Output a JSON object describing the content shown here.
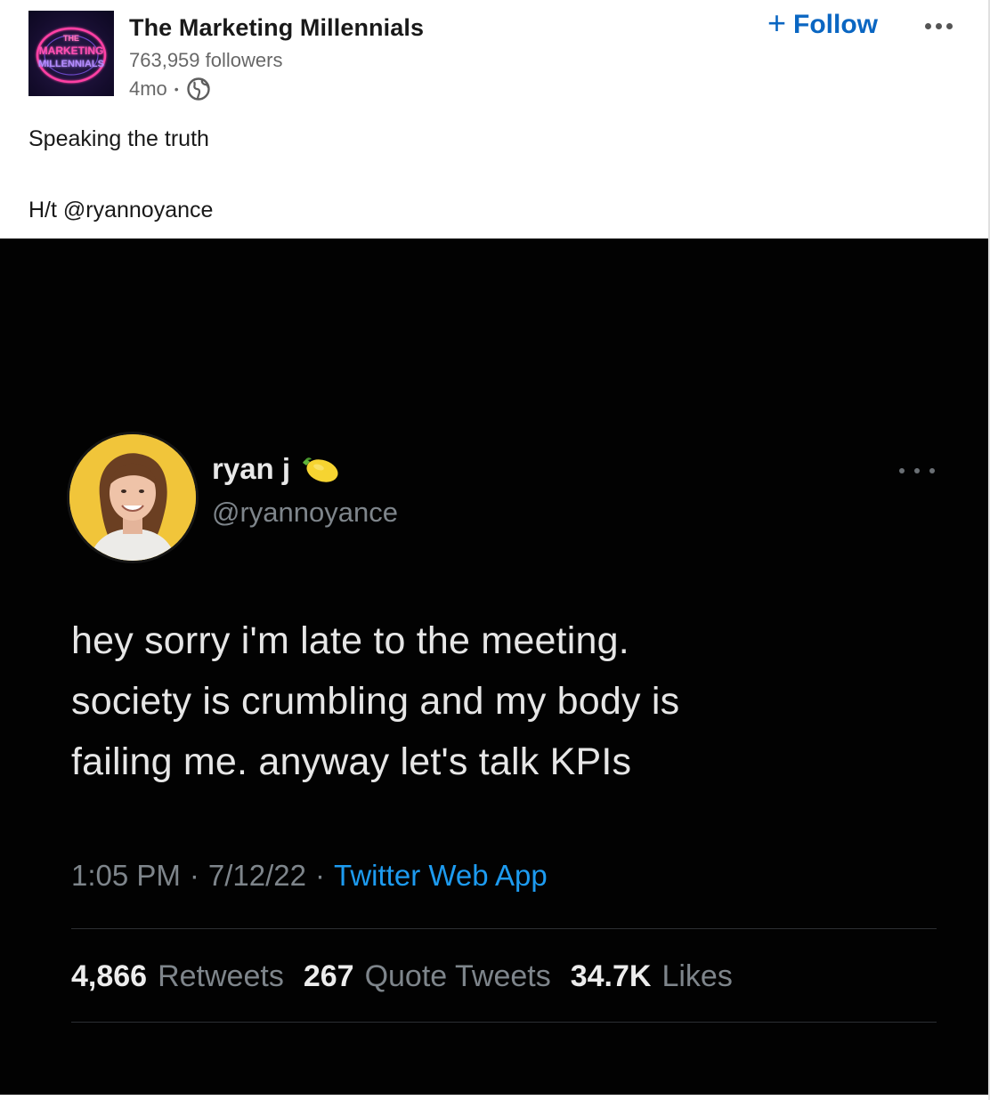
{
  "company": {
    "logo_lines": [
      "THE",
      "MARKETING",
      "MILLENNIALS"
    ],
    "name": "The Marketing Millennials",
    "followers": "763,959 followers",
    "age": "4mo",
    "separator": "•",
    "visibility_icon": "globe-icon"
  },
  "actions": {
    "follow_plus": "+",
    "follow_label": "Follow",
    "more_icon": "ellipsis-icon"
  },
  "post": {
    "line1": "Speaking the truth",
    "line2": "H/t @ryannoyance"
  },
  "tweet": {
    "display_name": "ryan j",
    "name_emoji_icon": "lemon-icon",
    "handle": "@ryannoyance",
    "body_lines": [
      "hey sorry i'm late to the meeting.",
      "society is crumbling and my body is",
      "failing me. anyway let's talk KPIs"
    ],
    "time": "1:05 PM",
    "date": "7/12/22",
    "dot": "·",
    "source": "Twitter Web App",
    "stats": [
      {
        "value": "4,866",
        "label": "Retweets"
      },
      {
        "value": "267",
        "label": "Quote Tweets"
      },
      {
        "value": "34.7K",
        "label": "Likes"
      }
    ]
  },
  "colors": {
    "link_blue": "#0a66c2",
    "twitter_blue": "#1d9bf0",
    "tweet_bg": "#020202",
    "avatar_bg": "#f1c53a"
  }
}
